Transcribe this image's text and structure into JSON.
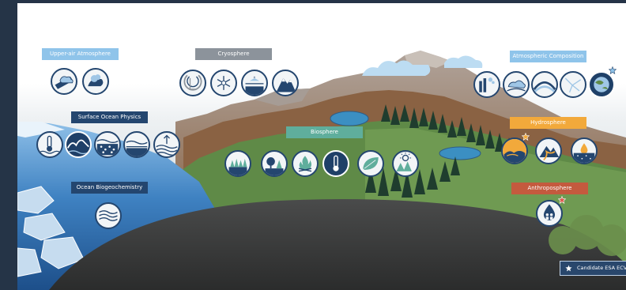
{
  "groups": {
    "upper_air": {
      "label": "Upper-air Atmosphere",
      "color": "#8fc4ea"
    },
    "cryosphere": {
      "label": "Cryosphere",
      "color": "#8c939b"
    },
    "atmospheric_composition": {
      "label": "Atmospheric Composition",
      "color": "#8fc4ea"
    },
    "surface_ocean": {
      "label": "Surface Ocean Physics",
      "color": "#24466f"
    },
    "biosphere": {
      "label": "Biosphere",
      "color": "#5fae9c"
    },
    "hydrosphere": {
      "label": "Hydrosphere",
      "color": "#f2a93b"
    },
    "ocean_bio": {
      "label": "Ocean Biogeochemistry",
      "color": "#24466f"
    },
    "anthroposphere": {
      "label": "Anthroposphere",
      "color": "#c45a3e"
    }
  },
  "icons": {
    "upper_air": [
      "cloud-icon",
      "cloud-dots-icon"
    ],
    "cryosphere": [
      "ice-sheet-icon",
      "snowflake-icon",
      "sea-ice-icon",
      "glacier-icon"
    ],
    "atmospheric_composition": [
      "aerosol-icon",
      "cloud-ozone-icon",
      "ozone-layer-icon",
      "greenhouse-gas-icon",
      "global-icon"
    ],
    "surface_ocean": [
      "sea-temperature-icon",
      "waves-icon",
      "sea-state-icon",
      "sea-level-icon",
      "surface-current-icon"
    ],
    "biosphere": [
      "land-cover-icon",
      "forest-icon",
      "fire-icon",
      "land-temperature-icon",
      "leaf-icon",
      "albedo-icon"
    ],
    "hydrosphere": [
      "lake-icon",
      "river-icon",
      "groundwater-icon"
    ],
    "ocean_bio": [
      "ocean-color-icon"
    ],
    "anthroposphere": [
      "water-use-icon"
    ]
  },
  "legend": {
    "label": "Candidate ESA ECVs",
    "icon": "star-icon"
  },
  "colors": {
    "background": "#253447",
    "ocean": "#2f70b2",
    "earth": "#3b3b3b",
    "star": "#e05a4e"
  }
}
